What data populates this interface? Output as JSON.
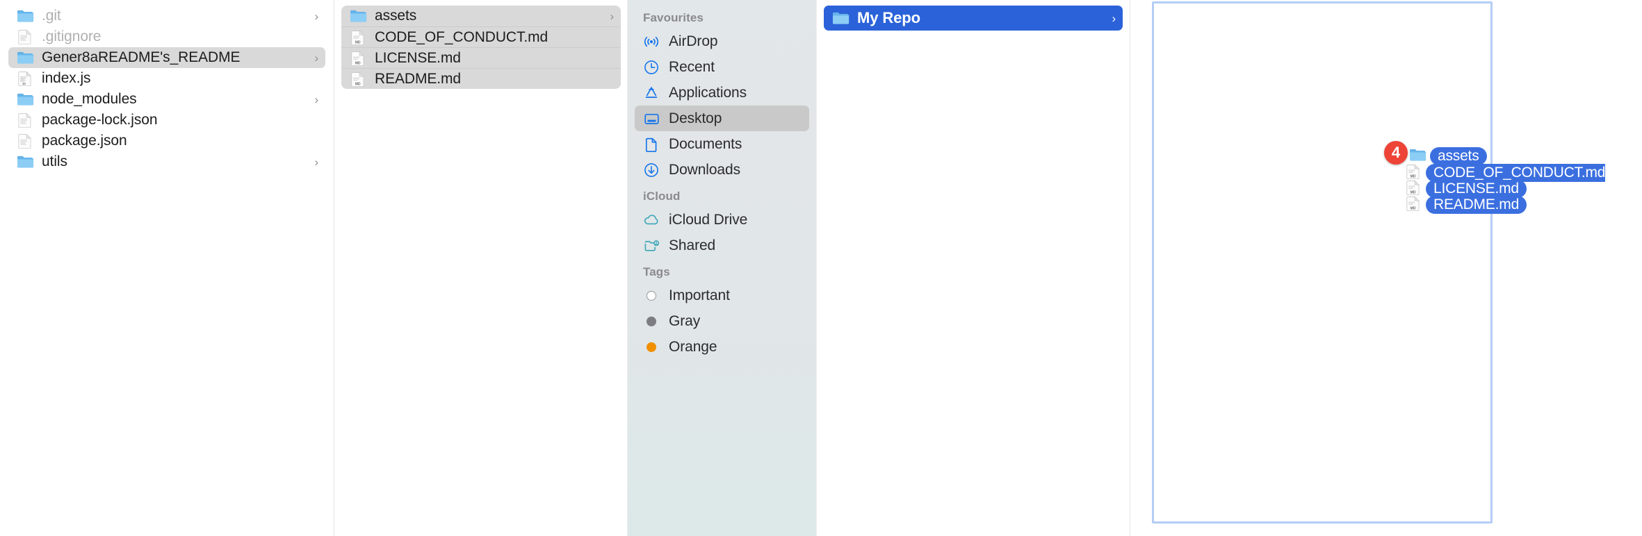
{
  "app": "Finder column view with drag-and-drop in progress",
  "column1": {
    "name": "parent-folder-column",
    "items": [
      {
        "label": ".git",
        "icon": "folder-icon",
        "state": "dimmed",
        "chevron": "›"
      },
      {
        "label": ".gitignore",
        "icon": "file-icon",
        "state": "dimmed",
        "chevron": ""
      },
      {
        "label": "Gener8aREADME's_README",
        "icon": "folder-icon",
        "state": "selected",
        "chevron": "›"
      },
      {
        "label": "index.js",
        "icon": "js-file-icon",
        "state": "normal",
        "chevron": ""
      },
      {
        "label": "node_modules",
        "icon": "folder-icon",
        "state": "normal",
        "chevron": "›"
      },
      {
        "label": "package-lock.json",
        "icon": "file-icon",
        "state": "normal",
        "chevron": ""
      },
      {
        "label": "package.json",
        "icon": "file-icon",
        "state": "normal",
        "chevron": ""
      },
      {
        "label": "utils",
        "icon": "folder-icon",
        "state": "normal",
        "chevron": "›"
      }
    ]
  },
  "column2": {
    "name": "selected-files-column",
    "items": [
      {
        "label": "assets",
        "icon": "folder-icon",
        "chevron": "›"
      },
      {
        "label": "CODE_OF_CONDUCT.md",
        "icon": "md-file-icon",
        "chevron": ""
      },
      {
        "label": "LICENSE.md",
        "icon": "md-file-icon",
        "chevron": ""
      },
      {
        "label": "README.md",
        "icon": "md-file-icon",
        "chevron": ""
      }
    ]
  },
  "sidebar": {
    "sections": [
      {
        "header": "Favourites",
        "items": [
          {
            "label": "AirDrop",
            "icon": "airdrop-icon",
            "active": false
          },
          {
            "label": "Recent",
            "icon": "clock-icon",
            "active": false
          },
          {
            "label": "Applications",
            "icon": "applications-icon",
            "active": false
          },
          {
            "label": "Desktop",
            "icon": "desktop-icon",
            "active": true
          },
          {
            "label": "Documents",
            "icon": "document-icon",
            "active": false
          },
          {
            "label": "Downloads",
            "icon": "download-icon",
            "active": false
          }
        ]
      },
      {
        "header": "iCloud",
        "items": [
          {
            "label": "iCloud Drive",
            "icon": "cloud-icon",
            "active": false
          },
          {
            "label": "Shared",
            "icon": "shared-folder-icon",
            "active": false
          }
        ]
      },
      {
        "header": "Tags",
        "items": [
          {
            "label": "Important",
            "icon": "tag-dot-icon",
            "color": "#ffffff",
            "active": false
          },
          {
            "label": "Gray",
            "icon": "tag-dot-icon",
            "color": "#7c7c82",
            "active": false
          },
          {
            "label": "Orange",
            "icon": "tag-dot-icon",
            "color": "#f09000",
            "active": false
          }
        ]
      }
    ]
  },
  "column4": {
    "name": "destination-column",
    "items": [
      {
        "label": "My Repo",
        "icon": "folder-icon",
        "selected": true,
        "chevron": "›"
      }
    ]
  },
  "drag": {
    "badge_count": "4",
    "items": [
      {
        "label": "assets",
        "icon": "folder-icon"
      },
      {
        "label": "CODE_OF_CONDUCT.md",
        "icon": "md-file-icon"
      },
      {
        "label": "LICENSE.md",
        "icon": "md-file-icon"
      },
      {
        "label": "README.md",
        "icon": "md-file-icon"
      }
    ]
  },
  "colors": {
    "selection_blue": "#2b62d9",
    "drag_pill_blue": "#3b6fe0",
    "badge_red": "#ee4337",
    "drop_border_blue": "#b4cdf5",
    "selection_gray": "#d9d9d9",
    "sidebar_bg": "#e1e6e8",
    "sidebar_icon_blue": "#1675ec",
    "icloud_icon_teal": "#3aa6b9"
  }
}
